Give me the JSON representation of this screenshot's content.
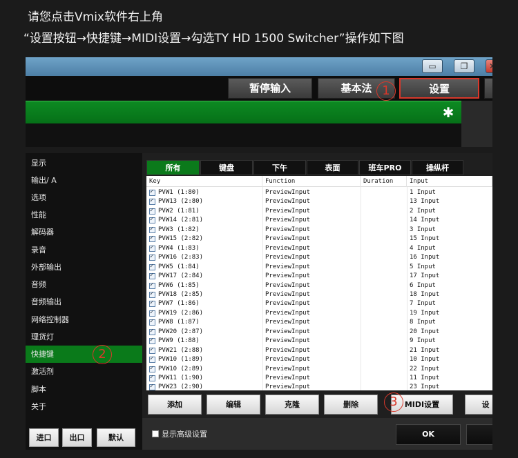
{
  "instruction": {
    "line1": "请您点击Vmix软件右上角",
    "line2": "“设置按钮→快捷键→MIDI设置→勾选TY HD 1500 Switcher”操作如下图"
  },
  "topwin": {
    "min_glyph": "▭",
    "max_glyph": "❐",
    "close_glyph": "✕",
    "toolbar": {
      "pause": "暂停输入",
      "basic": "基本法",
      "settings": "设置"
    },
    "gear_glyph": "✱"
  },
  "markers": [
    "1",
    "2",
    "3"
  ],
  "sidebar": {
    "items": [
      "显示",
      "输出/ A",
      "选项",
      "性能",
      "解码器",
      "录音",
      "外部输出",
      "音频",
      "音频输出",
      "网络控制器",
      "理货灯",
      "快捷键",
      "激活剂",
      "脚本",
      "关于"
    ],
    "active_index": 11,
    "import": "进口",
    "export": "出口",
    "default": "默认"
  },
  "tabs": [
    "所有",
    "键盘",
    "下午",
    "表面",
    "班车PRO",
    "操纵杆"
  ],
  "active_tab": 0,
  "list": {
    "headers": [
      "Key",
      "Function",
      "Duration",
      "Input"
    ],
    "rows": [
      [
        "PVW1 (1:80)",
        "PreviewInput",
        "",
        "1 Input"
      ],
      [
        "PVW13 (2:80)",
        "PreviewInput",
        "",
        "13 Input"
      ],
      [
        "PVW2 (1:81)",
        "PreviewInput",
        "",
        "2 Input"
      ],
      [
        "PVW14 (2:81)",
        "PreviewInput",
        "",
        "14 Input"
      ],
      [
        "PVW3 (1:82)",
        "PreviewInput",
        "",
        "3 Input"
      ],
      [
        "PVW15 (2:82)",
        "PreviewInput",
        "",
        "15 Input"
      ],
      [
        "PVW4 (1:83)",
        "PreviewInput",
        "",
        "4 Input"
      ],
      [
        "PVW16 (2:83)",
        "PreviewInput",
        "",
        "16 Input"
      ],
      [
        "PVW5 (1:84)",
        "PreviewInput",
        "",
        "5 Input"
      ],
      [
        "PVW17 (2:84)",
        "PreviewInput",
        "",
        "17 Input"
      ],
      [
        "PVW6 (1:85)",
        "PreviewInput",
        "",
        "6 Input"
      ],
      [
        "PVW18 (2:85)",
        "PreviewInput",
        "",
        "18 Input"
      ],
      [
        "PVW7 (1:86)",
        "PreviewInput",
        "",
        "7 Input"
      ],
      [
        "PVW19 (2:86)",
        "PreviewInput",
        "",
        "19 Input"
      ],
      [
        "PVW8 (1:87)",
        "PreviewInput",
        "",
        "8 Input"
      ],
      [
        "PVW20 (2:87)",
        "PreviewInput",
        "",
        "20 Input"
      ],
      [
        "PVW9 (1:88)",
        "PreviewInput",
        "",
        "9 Input"
      ],
      [
        "PVW21 (2:88)",
        "PreviewInput",
        "",
        "21 Input"
      ],
      [
        "PVW10 (1:89)",
        "PreviewInput",
        "",
        "10 Input"
      ],
      [
        "PVW10 (2:89)",
        "PreviewInput",
        "",
        "22 Input"
      ],
      [
        "PVW11 (1:90)",
        "PreviewInput",
        "",
        "11 Input"
      ],
      [
        "PVW23 (2:90)",
        "PreviewInput",
        "",
        "23 Input"
      ]
    ]
  },
  "actions": {
    "add": "添加",
    "edit": "编辑",
    "clone": "克隆",
    "delete": "删除",
    "midi": "MIDI设置",
    "more": "设"
  },
  "footer": {
    "advanced": "显示高级设置",
    "ok": "OK"
  },
  "colors": {
    "accent_green": "#0a7a1a",
    "marker_red": "#d9382b"
  }
}
